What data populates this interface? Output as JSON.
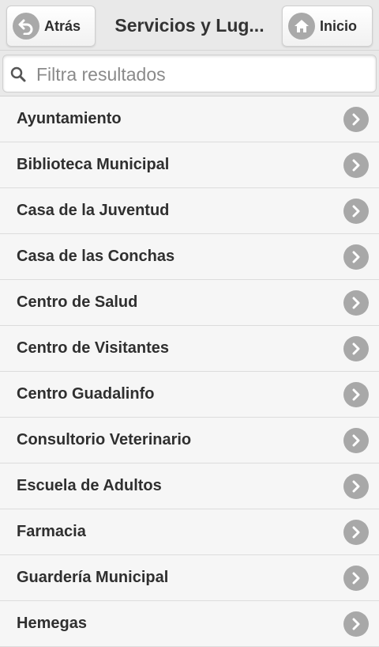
{
  "header": {
    "title": "Servicios y Lug...",
    "back_label": "Atrás",
    "home_label": "Inicio"
  },
  "search": {
    "placeholder": "Filtra resultados",
    "value": ""
  },
  "list": {
    "items": [
      {
        "label": "Ayuntamiento"
      },
      {
        "label": "Biblioteca Municipal"
      },
      {
        "label": "Casa de la Juventud"
      },
      {
        "label": "Casa de las Conchas"
      },
      {
        "label": "Centro de Salud"
      },
      {
        "label": "Centro de Visitantes"
      },
      {
        "label": "Centro Guadalinfo"
      },
      {
        "label": "Consultorio Veterinario"
      },
      {
        "label": "Escuela de Adultos"
      },
      {
        "label": "Farmacia"
      },
      {
        "label": "Guardería Municipal"
      },
      {
        "label": "Hemegas"
      }
    ]
  },
  "icons": {
    "back": "back-arrow-icon",
    "home": "home-icon",
    "search": "search-icon",
    "row": "chevron-right-icon"
  },
  "colors": {
    "header_bg": "#e9e9e9",
    "icon_circle": "#a8a8a8",
    "list_bg": "#f6f6f6",
    "text": "#2f2f2f"
  }
}
